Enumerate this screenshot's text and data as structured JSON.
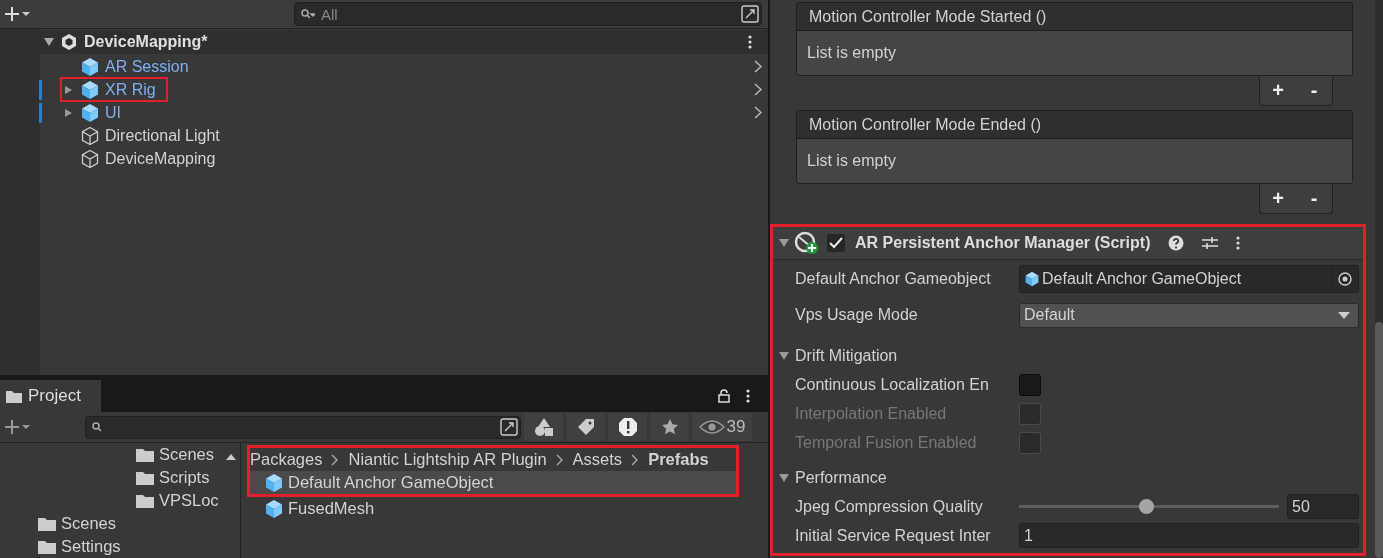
{
  "hierarchy": {
    "search_placeholder": "All",
    "scene": {
      "name": "DeviceMapping*",
      "expanded": true
    },
    "items": [
      {
        "name": "AR Session",
        "kind": "prefab",
        "has_children": false,
        "modified": false,
        "highlighted": false
      },
      {
        "name": "XR Rig",
        "kind": "prefab",
        "has_children": true,
        "modified": true,
        "highlighted": true
      },
      {
        "name": "UI",
        "kind": "prefab",
        "has_children": true,
        "modified": true,
        "highlighted": false
      },
      {
        "name": "Directional Light",
        "kind": "object",
        "has_children": false,
        "modified": false,
        "highlighted": false
      },
      {
        "name": "DeviceMapping",
        "kind": "object",
        "has_children": false,
        "modified": false,
        "highlighted": false
      }
    ]
  },
  "project": {
    "tab": "Project",
    "visible_count": "39",
    "folder_tree": [
      {
        "children": [
          {
            "name": "Scenes"
          },
          {
            "name": "Scripts"
          },
          {
            "name": "VPSLoc"
          }
        ]
      },
      {
        "name": "Scenes"
      },
      {
        "name": "Settings"
      }
    ],
    "breadcrumb": [
      "Packages",
      "Niantic Lightship AR Plugin",
      "Assets",
      "Prefabs"
    ],
    "highlighted": true,
    "files": [
      {
        "name": "Default Anchor GameObject",
        "selected": true
      },
      {
        "name": "FusedMesh",
        "selected": false
      }
    ]
  },
  "inspector": {
    "events": [
      {
        "title": "Motion Controller Mode Started ()",
        "body": "List is empty",
        "add": "+",
        "remove": "-"
      },
      {
        "title": "Motion Controller Mode Ended ()",
        "body": "List is empty",
        "add": "+",
        "remove": "-"
      }
    ],
    "component": {
      "title": "AR Persistent Anchor Manager (Script)",
      "enabled": true,
      "expanded": true,
      "highlighted": true,
      "fields": [
        {
          "kind": "object",
          "label": "Default Anchor Gameobject",
          "value": "Default Anchor GameObject"
        },
        {
          "kind": "dropdown",
          "label": "Vps Usage Mode",
          "value": "Default"
        },
        {
          "kind": "section",
          "label": "Drift Mitigation",
          "expanded": true
        },
        {
          "kind": "checkbox",
          "label": "Continuous Localization En",
          "checked": false,
          "disabled": false
        },
        {
          "kind": "checkbox",
          "label": "Interpolation Enabled",
          "checked": false,
          "disabled": true
        },
        {
          "kind": "checkbox",
          "label": "Temporal Fusion Enabled",
          "checked": false,
          "disabled": true
        },
        {
          "kind": "section",
          "label": "Performance",
          "expanded": true
        },
        {
          "kind": "slider",
          "label": "Jpeg Compression Quality",
          "level": 0.49,
          "value": "50"
        },
        {
          "kind": "number",
          "label": "Initial Service Request Inter",
          "value": "1"
        }
      ]
    }
  }
}
